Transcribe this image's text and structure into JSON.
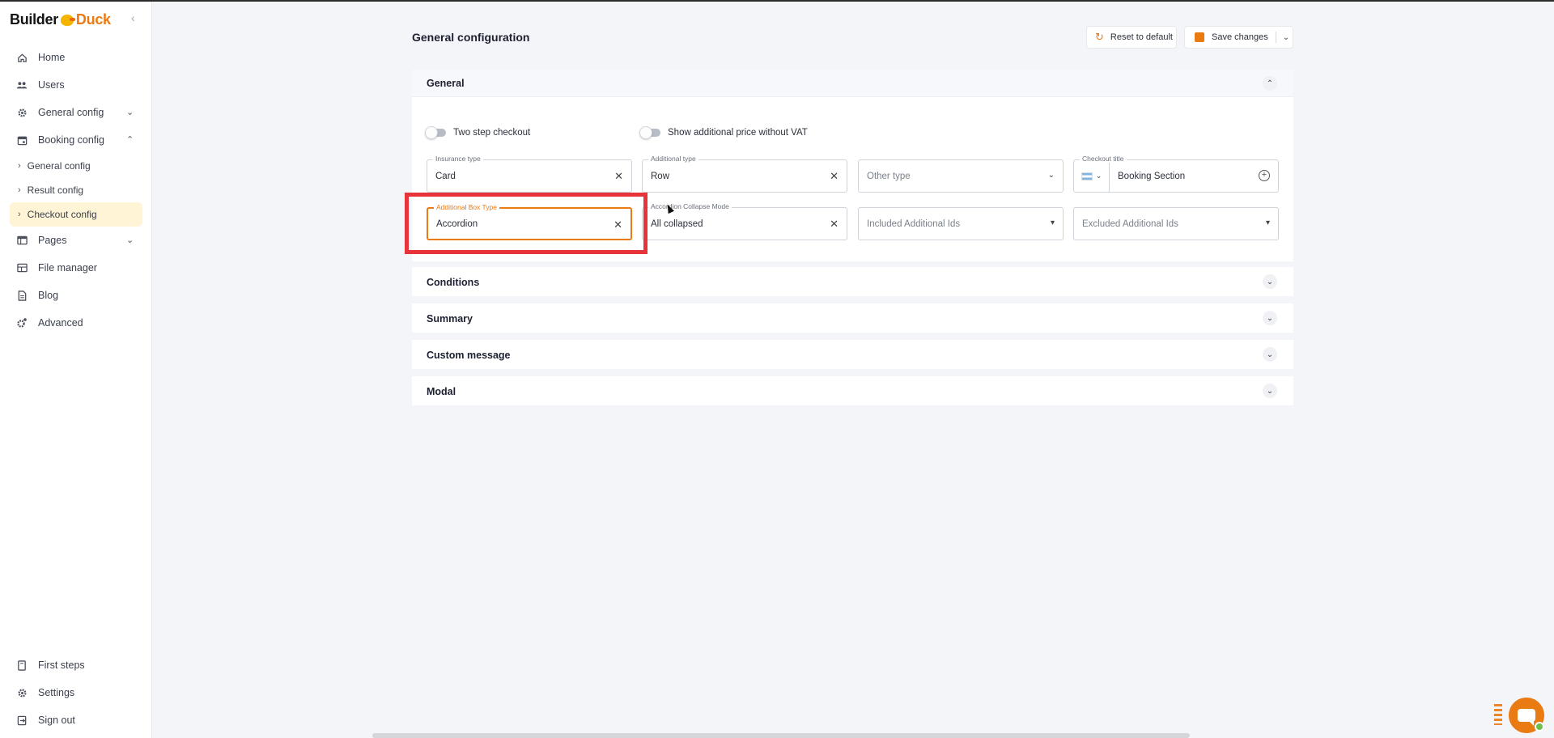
{
  "brand": {
    "part1": "Builder",
    "part2": "Duck",
    "collapse_icon": "chevron-left-icon"
  },
  "sidebar": {
    "items": [
      {
        "label": "Home",
        "icon": "home-icon"
      },
      {
        "label": "Users",
        "icon": "users-icon"
      },
      {
        "label": "General config",
        "icon": "gear-icon",
        "chevron": "⌄"
      },
      {
        "label": "Booking config",
        "icon": "calendar-icon",
        "chevron": "⌃"
      }
    ],
    "sub_items": [
      {
        "label": "General config"
      },
      {
        "label": "Result config"
      },
      {
        "label": "Checkout config",
        "active": true
      }
    ],
    "items2": [
      {
        "label": "Pages",
        "icon": "table-icon",
        "chevron": "⌄"
      },
      {
        "label": "File manager",
        "icon": "folder-icon"
      },
      {
        "label": "Blog",
        "icon": "document-icon"
      },
      {
        "label": "Advanced",
        "icon": "advanced-gear-icon"
      }
    ],
    "bottom": [
      {
        "label": "First steps",
        "icon": "book-icon"
      },
      {
        "label": "Settings",
        "icon": "gear-icon"
      },
      {
        "label": "Sign out",
        "icon": "sign-out-icon"
      }
    ]
  },
  "header": {
    "title": "General configuration",
    "reset_label": "Reset to default",
    "save_label": "Save changes"
  },
  "general": {
    "title": "General",
    "toggles": [
      {
        "label": "Two step checkout",
        "on": false
      },
      {
        "label": "Show additional price without VAT",
        "on": false
      }
    ],
    "row1": [
      {
        "label": "Insurance type",
        "value": "Card"
      },
      {
        "label": "Additional type",
        "value": "Row"
      },
      {
        "placeholder": "Other type"
      },
      {
        "label": "Checkout title",
        "value": "Booking Section"
      }
    ],
    "row2": [
      {
        "label": "Additional Box Type",
        "value": "Accordion"
      },
      {
        "label": "Accordion Collapse Mode",
        "value": "All collapsed"
      },
      {
        "placeholder": "Included Additional Ids"
      },
      {
        "placeholder": "Excluded Additional Ids"
      }
    ]
  },
  "sections": [
    {
      "title": "Conditions"
    },
    {
      "title": "Summary"
    },
    {
      "title": "Custom message"
    },
    {
      "title": "Modal"
    }
  ],
  "colors": {
    "accent": "#ea7a12",
    "highlight": "#e7343a",
    "active_bg": "#fff5d6"
  }
}
